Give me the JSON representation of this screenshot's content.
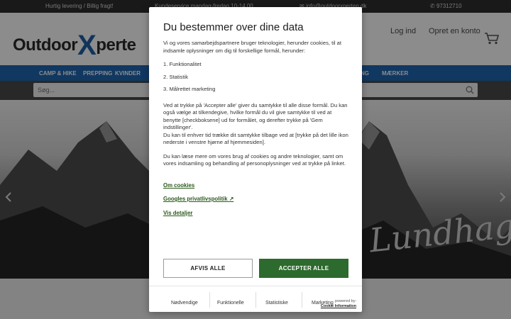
{
  "topbar": {
    "shipping": "Hurtig levering / Billig fragt!",
    "support": "Kundeservice mandag-fredag 10-14.00",
    "email": "info@outdoorxperten.dk",
    "phone": "97312710"
  },
  "header": {
    "logo_left": "Outdoor",
    "logo_x": "X",
    "logo_right": "perte",
    "login": "Log ind",
    "signup": "Opret en konto"
  },
  "nav": {
    "items": [
      "CAMP & HIKE",
      "PREPPING",
      "KVINDER",
      "NG",
      "MÆRKER"
    ]
  },
  "search": {
    "placeholder": "Søg..."
  },
  "hero": {
    "brand": "Lundhags",
    "reg": "®"
  },
  "consent": {
    "title": "Du bestemmer over dine data",
    "intro": "Vi og vores samarbejdspartnere bruger teknologier, herunder cookies, til at indsamle oplysninger om dig til forskellige formål, herunder:",
    "purposes": [
      "1. Funktionalitet",
      "2. Statistik",
      "3. Målrettet marketing"
    ],
    "para2": "Ved at trykke på 'Accepter alle' giver du samtykke til alle disse formål. Du kan også vælge at tilkendegive, hvilke formål du vil give samtykke til ved at benytte [checkboksene] ud for formålet, og derefter trykke på 'Gem indstillinger'.",
    "para3": "Du kan til enhver tid trække dit samtykke tilbage ved at [trykke på det lille ikon nederste i venstre hjørne af hjemmesiden].",
    "para4": "Du kan læse mere om vores brug af cookies og andre teknologier, samt om vores indsamling og behandling af personoplysninger ved at trykke på linket.",
    "link_cookies": "Om cookies",
    "link_google": "Googles privatlivspolitik",
    "link_details": "Vis detaljer",
    "decline": "AFVIS ALLE",
    "accept": "ACCEPTER ALLE",
    "categories": [
      "Nødvendige",
      "Funktionelle",
      "Statistiske",
      "Marketing"
    ],
    "powered_by": "powered by:",
    "powered_name": "Cookie Information"
  }
}
